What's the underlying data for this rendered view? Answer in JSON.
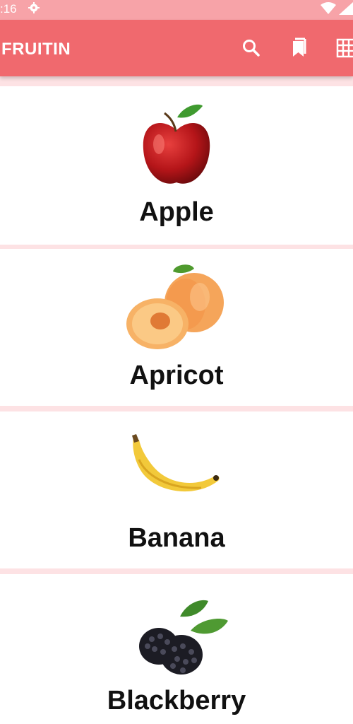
{
  "status_bar": {
    "time": ":16",
    "icons": [
      "gear-icon",
      "wifi-icon",
      "signal-icon"
    ]
  },
  "app_bar": {
    "title": "FRUITIN",
    "actions": [
      "search-icon",
      "bookmark-icon",
      "grid-view-icon"
    ],
    "color": "#f0696e"
  },
  "fruits": [
    {
      "name": "Apple",
      "icon": "apple-image"
    },
    {
      "name": "Apricot",
      "icon": "apricot-image"
    },
    {
      "name": "Banana",
      "icon": "banana-image"
    },
    {
      "name": "Blackberry",
      "icon": "blackberry-image"
    }
  ],
  "colors": {
    "background": "#fde2e4",
    "status_bar": "#f7a3a8",
    "card": "#ffffff"
  }
}
